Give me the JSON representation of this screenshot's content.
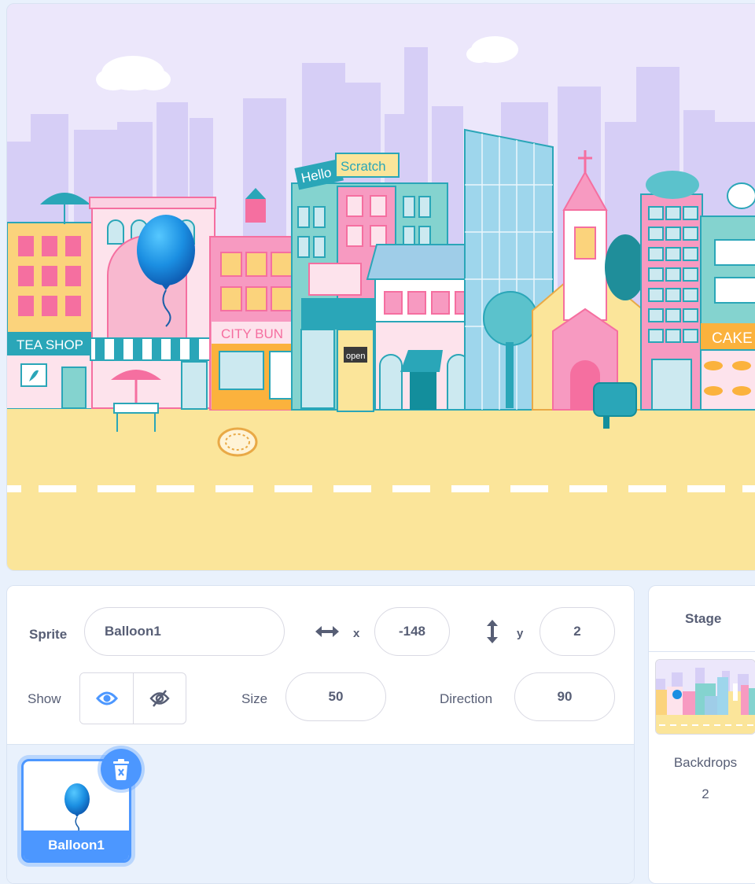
{
  "stage": {
    "backdrop_texts": {
      "hello": "Hello",
      "scratch": "Scratch",
      "tea_shop": "TEA SHOP",
      "city_bun": "CITY BUN",
      "cake": "CAKE",
      "open": "open"
    },
    "sprite_name": "Balloon1"
  },
  "sprite_info": {
    "sprite_label": "Sprite",
    "sprite_name": "Balloon1",
    "x_label": "x",
    "x_value": "-148",
    "y_label": "y",
    "y_value": "2",
    "show_label": "Show",
    "size_label": "Size",
    "size_value": "50",
    "direction_label": "Direction",
    "direction_value": "90",
    "show_visible": true
  },
  "sprite_list": {
    "items": [
      {
        "name": "Balloon1",
        "selected": true
      }
    ]
  },
  "stage_panel": {
    "title": "Stage",
    "backdrops_label": "Backdrops",
    "backdrops_count": "2"
  },
  "colors": {
    "accent": "#4c97ff",
    "text": "#575e75",
    "ground": "#fbe59a",
    "sky": "#ece7fb"
  }
}
